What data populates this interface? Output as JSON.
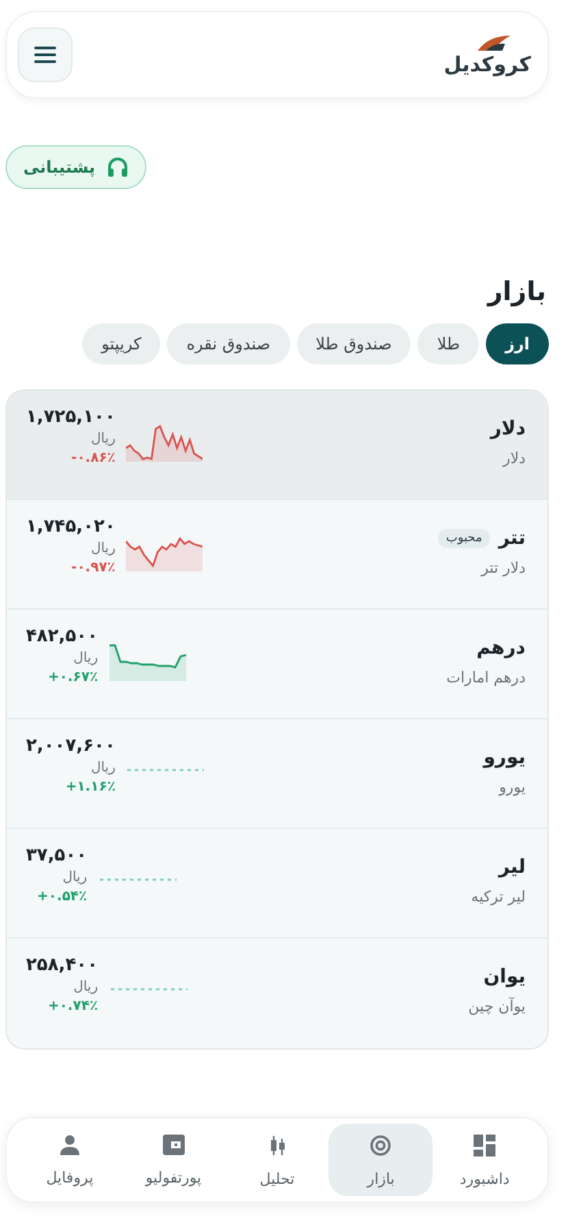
{
  "header": {
    "logo_text": "کروکدیل"
  },
  "support_button": {
    "label": "پشتیبانی"
  },
  "section_title": "بازار",
  "tabs": [
    {
      "label": "ارز",
      "selected": true
    },
    {
      "label": "طلا",
      "selected": false
    },
    {
      "label": "صندوق طلا",
      "selected": false
    },
    {
      "label": "صندوق نقره",
      "selected": false
    },
    {
      "label": "کریپتو",
      "selected": false
    }
  ],
  "rows": [
    {
      "name": "دلار",
      "subtitle": "دلار",
      "price": "۱,۷۲۵,۱۰۰",
      "unit": "ریال",
      "change": "-۰.۸۶٪",
      "kind": "down",
      "selected": true
    },
    {
      "name": "تتر",
      "badge": "محبوب",
      "subtitle": "دلار تتر",
      "price": "۱,۷۴۵,۰۲۰",
      "unit": "ریال",
      "change": "-۰.۹۷٪",
      "kind": "down",
      "selected": false
    },
    {
      "name": "درهم",
      "subtitle": "درهم امارات",
      "price": "۴۸۲,۵۰۰",
      "unit": "ریال",
      "change": "+۰.۶۷٪",
      "kind": "up",
      "selected": false
    },
    {
      "name": "یورو",
      "subtitle": "یورو",
      "price": "۲,۰۰۷,۶۰۰",
      "unit": "ریال",
      "change": "+۱.۱۶٪",
      "kind": "flat",
      "selected": false
    },
    {
      "name": "لیر",
      "subtitle": "لیر ترکیه",
      "price": "۳۷,۵۰۰",
      "unit": "ریال",
      "change": "+۰.۵۴٪",
      "kind": "flat",
      "selected": false
    },
    {
      "name": "یوان",
      "subtitle": "یوآن چین",
      "price": "۲۵۸,۴۰۰",
      "unit": "ریال",
      "change": "+۰.۷۴٪",
      "kind": "flat",
      "selected": false
    }
  ],
  "bottom_nav": [
    {
      "label": "داشبورد",
      "kind": "dashboard",
      "selected": false
    },
    {
      "label": "بازار",
      "kind": "market",
      "selected": true
    },
    {
      "label": "تحلیل",
      "kind": "candles",
      "selected": false
    },
    {
      "label": "پورتفولیو",
      "kind": "wallet",
      "selected": false
    },
    {
      "label": "پروفایل",
      "kind": "person",
      "selected": false
    }
  ]
}
